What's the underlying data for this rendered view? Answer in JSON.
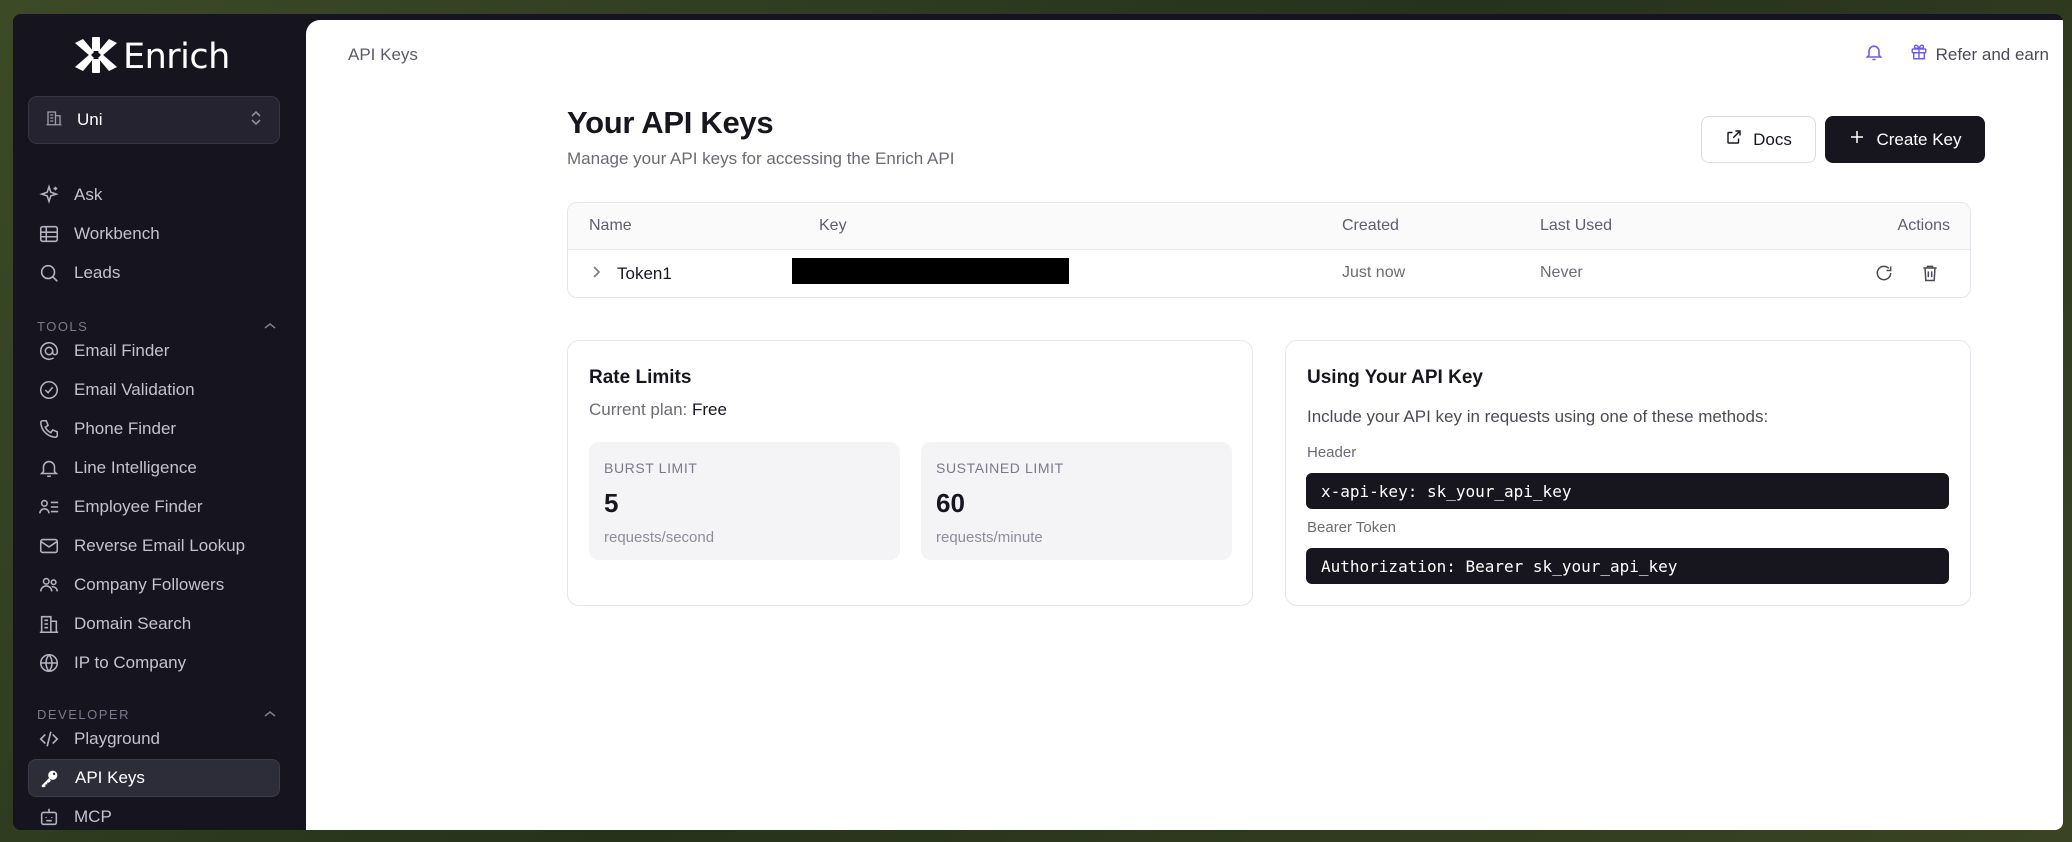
{
  "sidebar": {
    "logo_text": "Enrich",
    "org_name": "Uni",
    "main_items": [
      {
        "label": "Ask",
        "icon": "sparkle-icon"
      },
      {
        "label": "Workbench",
        "icon": "table-icon"
      },
      {
        "label": "Leads",
        "icon": "search-icon"
      }
    ],
    "tools_header": "TOOLS",
    "tools": [
      {
        "label": "Email Finder",
        "icon": "at-icon"
      },
      {
        "label": "Email Validation",
        "icon": "check-circle-icon"
      },
      {
        "label": "Phone Finder",
        "icon": "phone-icon"
      },
      {
        "label": "Line Intelligence",
        "icon": "bell-icon"
      },
      {
        "label": "Employee Finder",
        "icon": "user-list-icon"
      },
      {
        "label": "Reverse Email Lookup",
        "icon": "mail-icon"
      },
      {
        "label": "Company Followers",
        "icon": "users-icon"
      },
      {
        "label": "Domain Search",
        "icon": "building-icon"
      },
      {
        "label": "IP to Company",
        "icon": "globe-icon"
      }
    ],
    "developer_header": "DEVELOPER",
    "developer": [
      {
        "label": "Playground",
        "icon": "code-icon"
      },
      {
        "label": "API Keys",
        "icon": "key-icon",
        "active": true
      },
      {
        "label": "MCP",
        "icon": "bot-icon"
      }
    ]
  },
  "topbar": {
    "breadcrumb": "API Keys",
    "refer_label": "Refer and earn"
  },
  "page": {
    "title": "Your API Keys",
    "subtitle": "Manage your API keys for accessing the Enrich API",
    "docs_label": "Docs",
    "create_label": "Create Key"
  },
  "keys_table": {
    "headers": {
      "name": "Name",
      "key": "Key",
      "created": "Created",
      "last_used": "Last Used",
      "actions": "Actions"
    },
    "rows": [
      {
        "name": "Token1",
        "key": "",
        "created": "Just now",
        "last_used": "Never"
      }
    ]
  },
  "rate_limits": {
    "title": "Rate Limits",
    "plan_prefix": "Current plan: ",
    "plan": "Free",
    "burst": {
      "label": "BURST LIMIT",
      "value": "5",
      "unit": "requests/second"
    },
    "sustained": {
      "label": "SUSTAINED LIMIT",
      "value": "60",
      "unit": "requests/minute"
    }
  },
  "usage": {
    "title": "Using Your API Key",
    "description": "Include your API key in requests using one of these methods:",
    "header_label": "Header",
    "header_code": "x-api-key: sk_your_api_key",
    "bearer_label": "Bearer Token",
    "bearer_code": "Authorization: Bearer sk_your_api_key"
  },
  "colors": {
    "sidebar_bg": "#15141f",
    "accent": "#6d5ce8",
    "primary_button": "#17161f"
  }
}
